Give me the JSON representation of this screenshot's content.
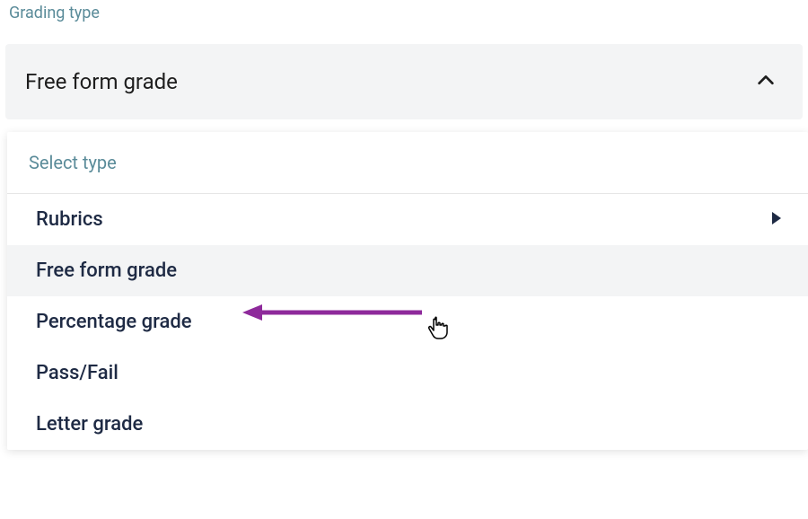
{
  "field_label": "Grading type",
  "trigger": {
    "selected_text": "Free form grade"
  },
  "panel": {
    "header": "Select type",
    "options": [
      {
        "label": "Rubrics",
        "has_submenu": true,
        "highlighted": false
      },
      {
        "label": "Free form grade",
        "has_submenu": false,
        "highlighted": true
      },
      {
        "label": "Percentage grade",
        "has_submenu": false,
        "highlighted": false
      },
      {
        "label": "Pass/Fail",
        "has_submenu": false,
        "highlighted": false
      },
      {
        "label": "Letter grade",
        "has_submenu": false,
        "highlighted": false
      }
    ]
  },
  "annotation": {
    "arrow_color": "#8e2a9b"
  }
}
